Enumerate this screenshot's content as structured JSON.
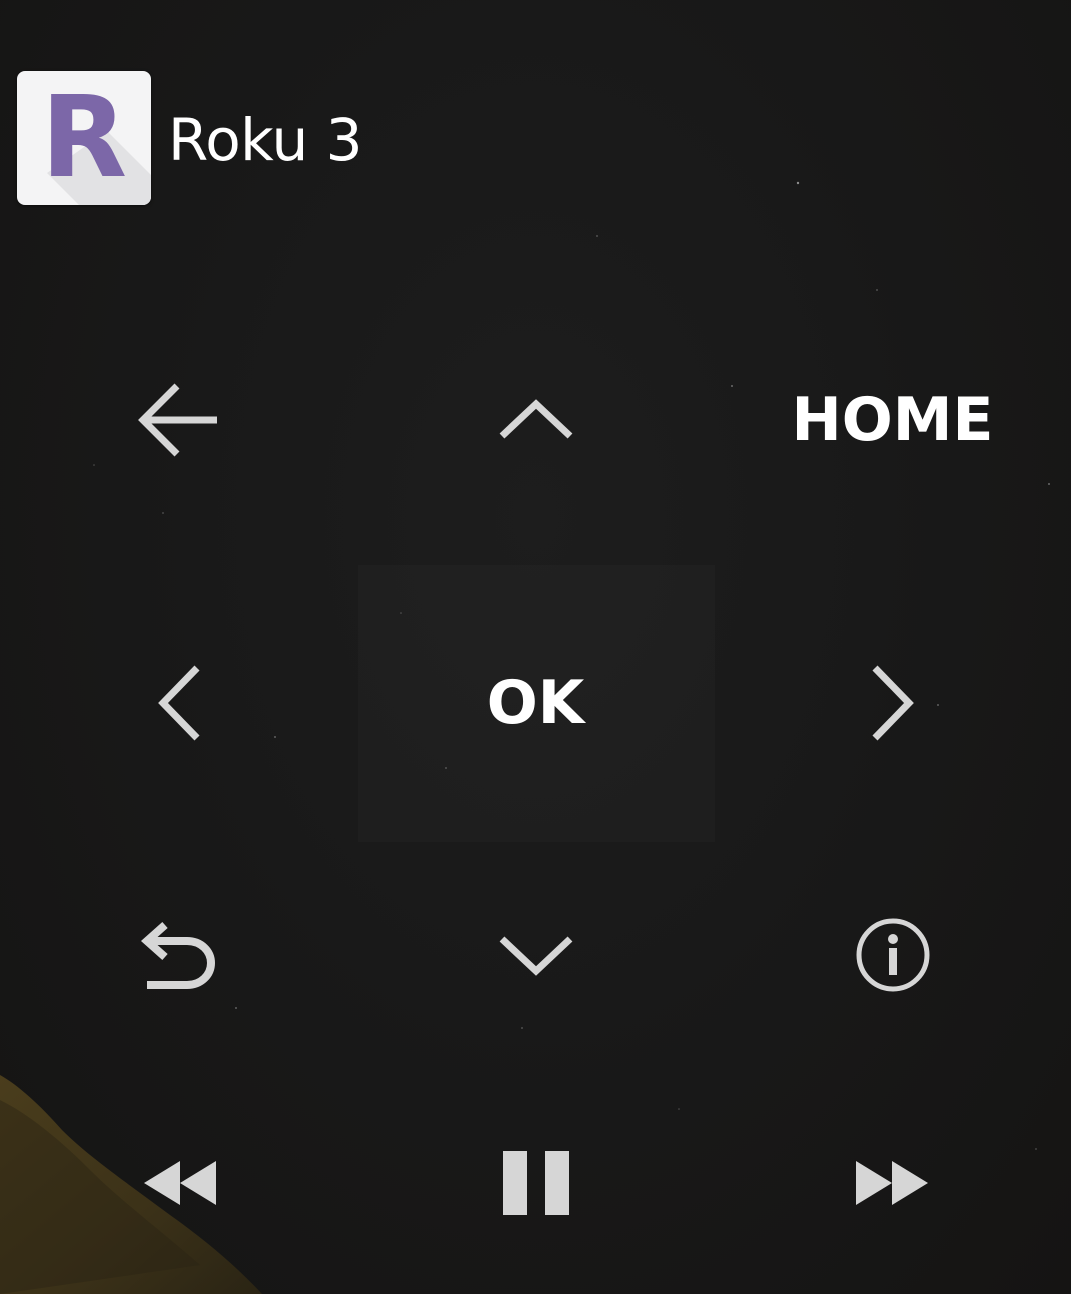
{
  "header": {
    "logo_letter": "R",
    "device_name": "Roku 3"
  },
  "remote": {
    "back_icon": "arrow-left-icon",
    "up_icon": "chevron-up-icon",
    "home_label": "HOME",
    "left_icon": "chevron-left-icon",
    "ok_label": "OK",
    "right_icon": "chevron-right-icon",
    "replay_icon": "replay-icon",
    "down_icon": "chevron-down-icon",
    "info_icon": "info-icon",
    "rewind_icon": "rewind-icon",
    "play_pause_icon": "pause-icon",
    "fast_forward_icon": "fast-forward-icon"
  },
  "colors": {
    "logo_accent": "#7c67a8",
    "logo_background": "#f4f4f5",
    "icon": "#d6d6d6",
    "text": "#ffffff",
    "background": "#191919"
  }
}
